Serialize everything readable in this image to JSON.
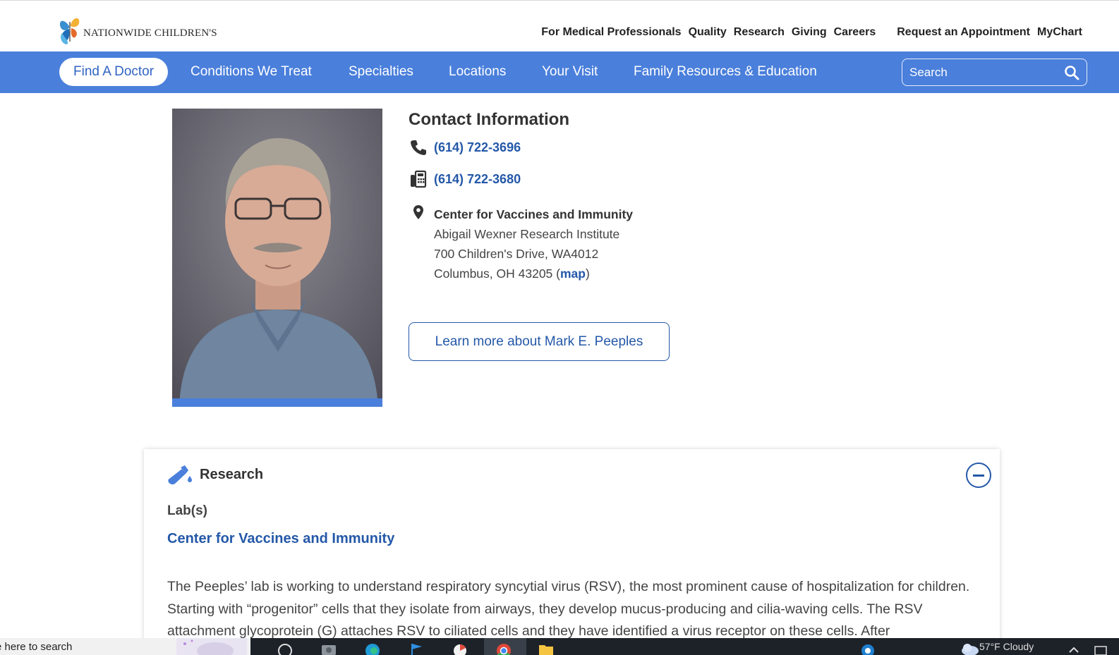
{
  "header": {
    "logo_text": "NATIONWIDE CHILDREN'S",
    "util_links": [
      "For Medical Professionals",
      "Quality",
      "Research",
      "Giving",
      "Careers"
    ],
    "appointment_link": "Request an Appointment",
    "mychart_link": "MyChart"
  },
  "nav": {
    "items": [
      "Find A Doctor",
      "Conditions We Treat",
      "Specialties",
      "Locations",
      "Your Visit",
      "Family Resources & Education"
    ],
    "active": "Find A Doctor",
    "search_placeholder": "Search",
    "accent": "#4a7fdb"
  },
  "contact": {
    "title": "Contact Information",
    "phone": "(614) 722-3696",
    "fax": "(614) 722-3680",
    "location_name": "Center for Vaccines and Immunity",
    "address_line1": "Abigail Wexner Research Institute",
    "address_line2": "700 Children's Drive, WA4012",
    "address_line3_prefix": "Columbus, OH 43205 (",
    "map_link": "map",
    "address_line3_suffix": ")"
  },
  "profile": {
    "learn_more_button": "Learn more about Mark E. Peeples"
  },
  "research": {
    "title": "Research",
    "labs_label": "Lab(s)",
    "lab_link": "Center for Vaccines and Immunity",
    "description": "The Peeples’ lab is working to understand respiratory syncytial virus (RSV), the most prominent cause of hospitalization for children. Starting with “progenitor” cells that they isolate from airways, they develop mucus-producing and cilia-waving cells. The RSV attachment glycoprotein (G) attaches RSV to ciliated cells and they have identified a virus receptor on these cells. After"
  },
  "taskbar": {
    "search_text": "e here to search",
    "weather": "57°F  Cloudy"
  },
  "colors": {
    "link": "#2458a8",
    "nav_bg": "#4a7fdb",
    "taskbar_bg": "#1d2229"
  }
}
